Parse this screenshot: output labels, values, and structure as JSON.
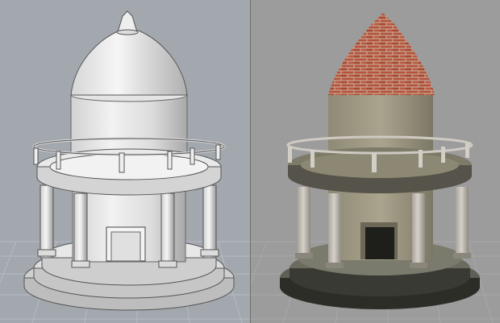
{
  "viewports": [
    {
      "name": "shaded",
      "mode": "Shaded",
      "background": "#a3a8ae",
      "model_color": "#d8d8d8"
    },
    {
      "name": "rendered",
      "mode": "Rendered",
      "background": "#9c9c9c",
      "brick": "#b5533c",
      "stucco": "#a49e88",
      "stone": "#c7c3bc"
    }
  ],
  "model": "tempietto"
}
